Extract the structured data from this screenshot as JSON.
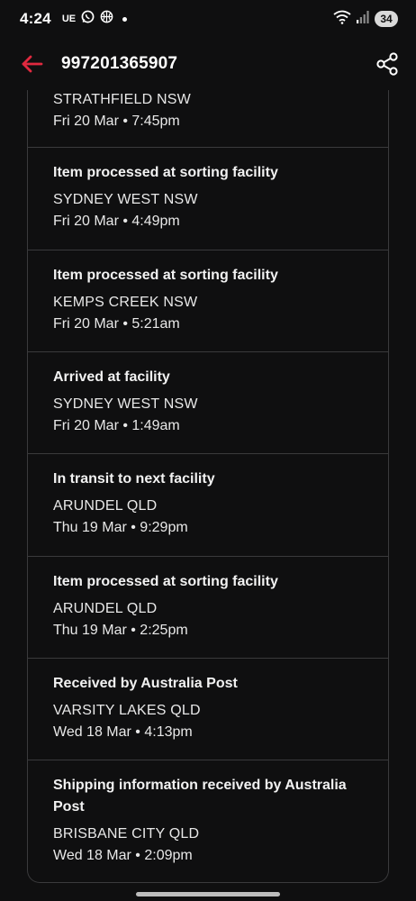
{
  "status_bar": {
    "time": "4:24",
    "carrier_label": "UE",
    "battery": "34",
    "wifi_label": "6"
  },
  "app_bar": {
    "title": "997201365907",
    "back_icon": "arrow-left-icon",
    "share_icon": "share-icon",
    "accent_color": "#e0293f"
  },
  "events": [
    {
      "status": "",
      "location": "STRATHFIELD NSW",
      "time": "Fri 20 Mar • 7:45pm"
    },
    {
      "status": "Item processed at sorting facility",
      "location": "SYDNEY WEST NSW",
      "time": "Fri 20 Mar • 4:49pm"
    },
    {
      "status": "Item processed at sorting facility",
      "location": "KEMPS CREEK NSW",
      "time": "Fri 20 Mar • 5:21am"
    },
    {
      "status": "Arrived at facility",
      "location": "SYDNEY WEST NSW",
      "time": "Fri 20 Mar • 1:49am"
    },
    {
      "status": "In transit to next facility",
      "location": "ARUNDEL QLD",
      "time": "Thu 19 Mar • 9:29pm"
    },
    {
      "status": "Item processed at sorting facility",
      "location": "ARUNDEL QLD",
      "time": "Thu 19 Mar • 2:25pm"
    },
    {
      "status": "Received by Australia Post",
      "location": "VARSITY LAKES QLD",
      "time": "Wed 18 Mar • 4:13pm"
    },
    {
      "status": "Shipping information received by Australia Post",
      "location": "BRISBANE CITY QLD",
      "time": "Wed 18 Mar • 2:09pm"
    }
  ]
}
